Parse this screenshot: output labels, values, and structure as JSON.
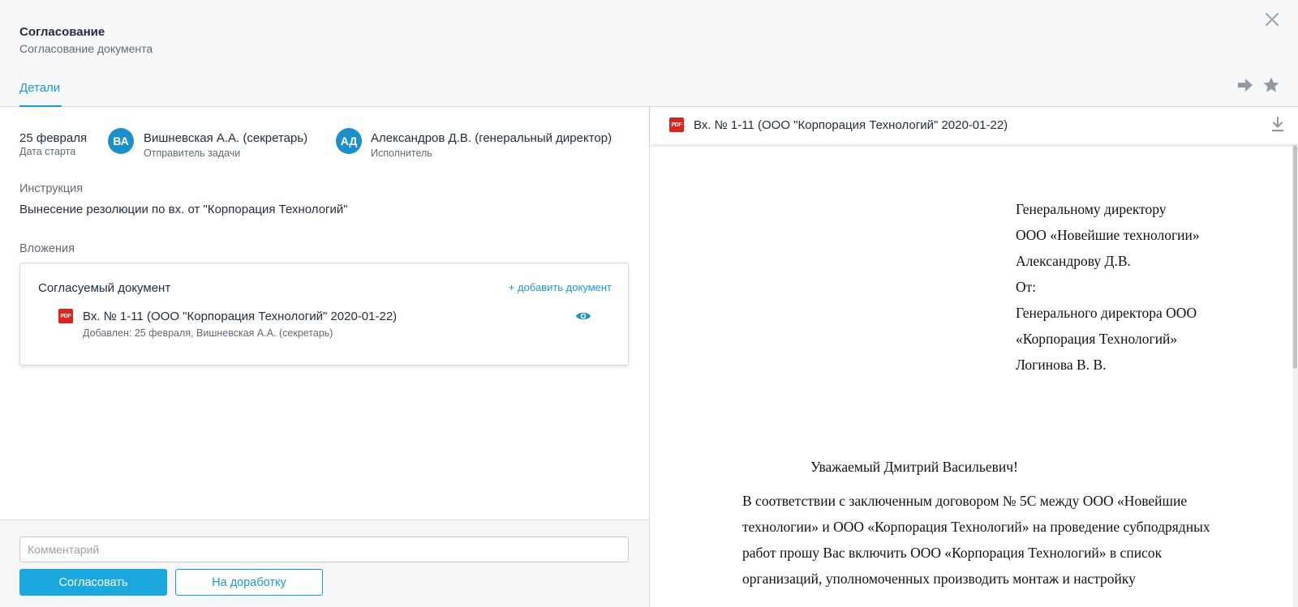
{
  "header": {
    "title": "Согласование",
    "subtitle": "Согласование документа",
    "tabs": [
      {
        "label": "Детали",
        "active": true
      }
    ]
  },
  "icons": {
    "close": "close-icon",
    "forward": "arrow-right-icon",
    "favorite": "star-icon",
    "file": "pdf-icon",
    "preview": "eye-icon",
    "download": "download-icon"
  },
  "task": {
    "start_date": "25 февраля",
    "start_date_label": "Дата старта",
    "sender": {
      "initials": "ВА",
      "name": "Вишневская А.А. (секретарь)",
      "role": "Отправитель задачи"
    },
    "executor": {
      "initials": "АД",
      "name": "Александров Д.В. (генеральный директор)",
      "role": "Исполнитель"
    }
  },
  "instruction": {
    "label": "Инструкция",
    "text": "Вынесение резолюции по вх. от \"Корпорация Технологий\""
  },
  "attachments": {
    "label": "Вложения",
    "card_title": "Согласуемый документ",
    "add_link": "+ добавить документ",
    "file_badge": "PDF",
    "items": [
      {
        "name": "Вх. № 1-11 (ООО \"Корпорация Технологий\" 2020-01-22)",
        "added": "Добавлен: 25 февраля, Вишневская А.А. (секретарь)"
      }
    ]
  },
  "footer": {
    "comment_placeholder": "Комментарий",
    "approve_label": "Согласовать",
    "rework_label": "На доработку"
  },
  "viewer": {
    "title": "Вх. № 1-11 (ООО \"Корпорация Технологий\" 2020-01-22)",
    "file_badge": "PDF",
    "address_lines": [
      "Генеральному директору",
      "ООО «Новейшие технологии»",
      "Александрову Д.В.",
      "От:",
      "Генерального директора ООО",
      "«Корпорация Технологий»",
      "Логинова В. В."
    ],
    "greeting": "Уважаемый Дмитрий Васильевич!",
    "body_lines": [
      "В соответствии с заключенным договором № 5С между ООО «Новейшие",
      "технологии» и ООО «Корпорация Технологий» на проведение субподрядных",
      "работ прошу Вас включить ООО «Корпорация Технологий» в список",
      "организаций, уполномоченных производить монтаж и настройку"
    ]
  },
  "colors": {
    "accent": "#1a9bd7",
    "primary_button": "#1aa8de",
    "avatar": "#1a8fc9",
    "pdf": "#d9261c",
    "header_bg": "#f7f8fa"
  }
}
